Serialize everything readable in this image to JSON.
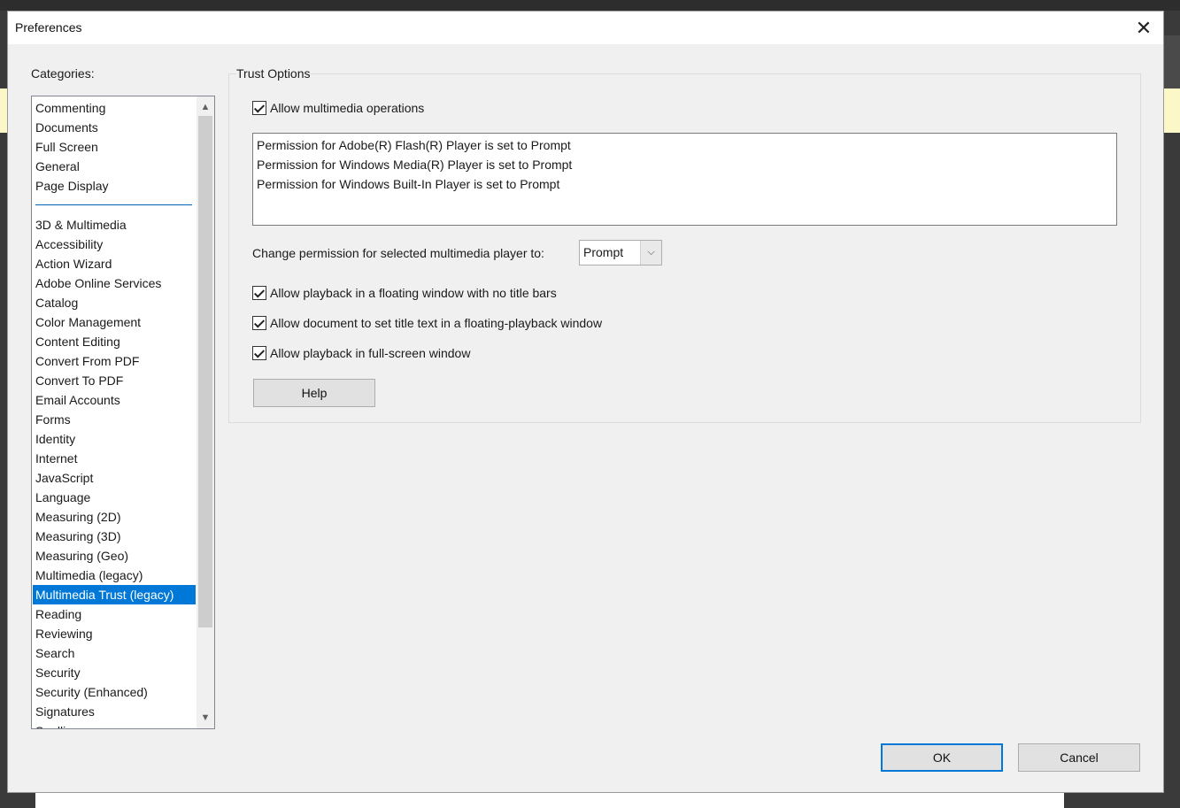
{
  "dialog": {
    "title": "Preferences",
    "close_icon": "close-icon"
  },
  "categories": {
    "label": "Categories:",
    "group1": [
      "Commenting",
      "Documents",
      "Full Screen",
      "General",
      "Page Display"
    ],
    "group2": [
      "3D & Multimedia",
      "Accessibility",
      "Action Wizard",
      "Adobe Online Services",
      "Catalog",
      "Color Management",
      "Content Editing",
      "Convert From PDF",
      "Convert To PDF",
      "Email Accounts",
      "Forms",
      "Identity",
      "Internet",
      "JavaScript",
      "Language",
      "Measuring (2D)",
      "Measuring (3D)",
      "Measuring (Geo)",
      "Multimedia (legacy)",
      "Multimedia Trust (legacy)",
      "Reading",
      "Reviewing",
      "Search",
      "Security",
      "Security (Enhanced)",
      "Signatures",
      "Spelling"
    ],
    "selected": "Multimedia Trust (legacy)"
  },
  "trust": {
    "legend": "Trust Options",
    "allow_multimedia": {
      "label": "Allow multimedia operations",
      "checked": true
    },
    "permissions": [
      "Permission for Adobe(R) Flash(R) Player is set to Prompt",
      "Permission for Windows Media(R) Player is set to Prompt",
      "Permission for Windows Built-In Player is set to Prompt"
    ],
    "change_label": "Change permission for selected multimedia player to:",
    "change_value": "Prompt",
    "floating_no_title": {
      "label": "Allow playback in a floating window with no title bars",
      "checked": true
    },
    "doc_title_text": {
      "label": "Allow document to set title text in a floating-playback window",
      "checked": true
    },
    "full_screen": {
      "label": "Allow playback in full-screen window",
      "checked": true
    },
    "help": "Help"
  },
  "footer": {
    "ok": "OK",
    "cancel": "Cancel"
  },
  "colors": {
    "selection": "#0078d7",
    "dialog_bg": "#f0f0f0"
  }
}
